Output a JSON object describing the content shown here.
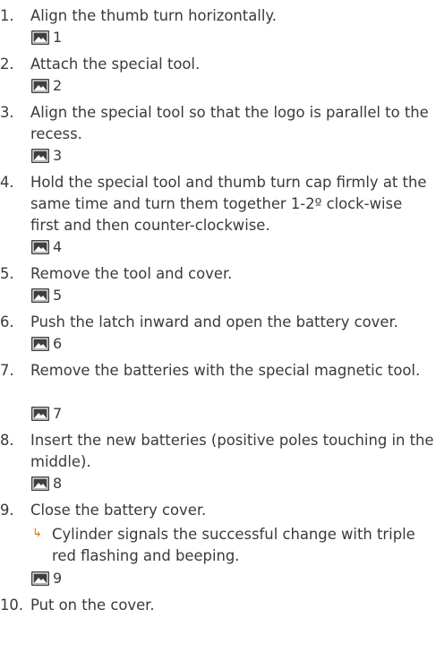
{
  "steps": [
    {
      "number": "1.",
      "text": "Align the thumb turn horizontally.",
      "figure": "1"
    },
    {
      "number": "2.",
      "text": "Attach the special tool.",
      "figure": "2"
    },
    {
      "number": "3.",
      "text": "Align the special tool so that the logo is parallel to the recess.",
      "figure": "3"
    },
    {
      "number": "4.",
      "text": "Hold the special tool and thumb turn cap firmly at the same time and turn them together 1-2º clock-wise first and then counter-clockwise.",
      "figure": "4"
    },
    {
      "number": "5.",
      "text": "Remove the tool and cover.",
      "figure": "5"
    },
    {
      "number": "6.",
      "text": "Push the latch inward and open the battery cover.",
      "figure": "6"
    },
    {
      "number": "7.",
      "text": "Remove the batteries with the special magnetic tool.",
      "figure": "7"
    },
    {
      "number": "8.",
      "text": "Insert the new batteries (positive poles touching in the middle).",
      "figure": "8"
    },
    {
      "number": "9.",
      "text": "Close the battery cover.",
      "result": "Cylinder signals the successful change with triple red flashing and beeping.",
      "figure": "9"
    },
    {
      "number": "10.",
      "text": "Put on the cover."
    }
  ],
  "icons": {
    "figure": "image-icon",
    "result": "result-arrow-icon"
  },
  "colors": {
    "text": "#3a3a3a",
    "icon": "#3f3f3f",
    "result_arrow": "#e07a10"
  }
}
